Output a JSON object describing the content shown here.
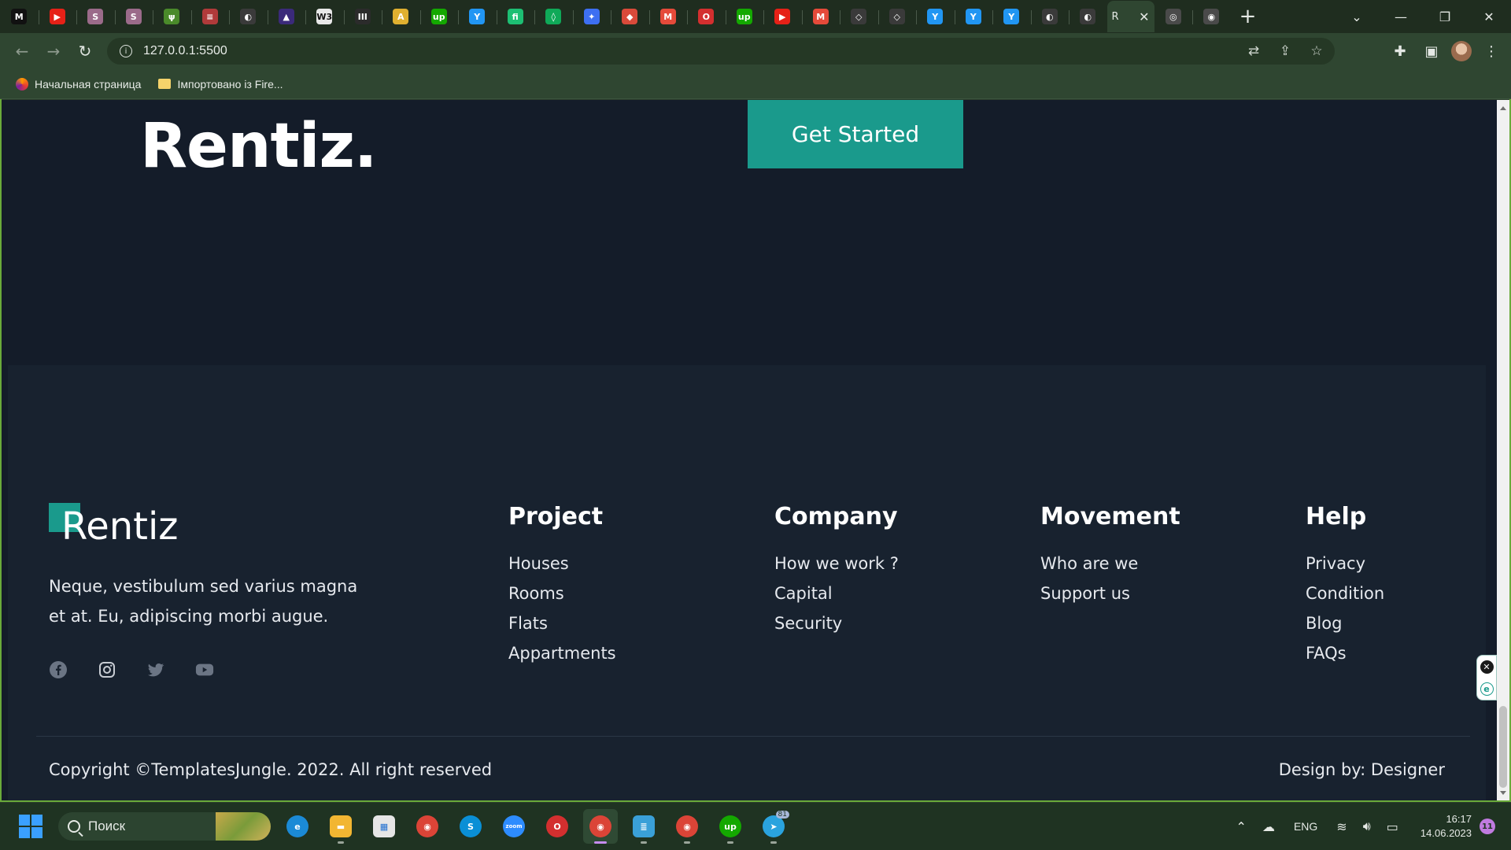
{
  "browser": {
    "active_tab_title": "R",
    "tabs": [
      {
        "icon": "medium-icon",
        "glyph": "M",
        "color": "#111111"
      },
      {
        "icon": "youtube-icon",
        "glyph": "▶",
        "color": "#e62117"
      },
      {
        "icon": "book-icon",
        "glyph": "S",
        "color": "#9b6b8a"
      },
      {
        "icon": "book-icon",
        "glyph": "S",
        "color": "#9b6b8a"
      },
      {
        "icon": "leaf-icon",
        "glyph": "ψ",
        "color": "#4a8a2a"
      },
      {
        "icon": "stack-icon",
        "glyph": "≡",
        "color": "#b03a3a"
      },
      {
        "icon": "globe-icon",
        "glyph": "◐",
        "color": "#3a3a3a"
      },
      {
        "icon": "mountain-icon",
        "glyph": "▲",
        "color": "#3b2a7a"
      },
      {
        "icon": "w3schools-icon",
        "glyph": "W3",
        "color": "#e8e8e8"
      },
      {
        "icon": "gallery-icon",
        "glyph": "III",
        "color": "#2b2b2b"
      },
      {
        "icon": "translate-icon",
        "glyph": "A",
        "color": "#e0b030"
      },
      {
        "icon": "upwork-icon",
        "glyph": "up",
        "color": "#14a800"
      },
      {
        "icon": "bird-icon",
        "glyph": "Y",
        "color": "#2196f3"
      },
      {
        "icon": "fiverr-icon",
        "glyph": "fi",
        "color": "#1dbf73"
      },
      {
        "icon": "drop-icon",
        "glyph": "◊",
        "color": "#0fa958"
      },
      {
        "icon": "figma-icon",
        "glyph": "✦",
        "color": "#3d6ff2"
      },
      {
        "icon": "diamond-icon",
        "glyph": "◆",
        "color": "#d94a3a"
      },
      {
        "icon": "gmail-icon",
        "glyph": "M",
        "color": "#e54a3a"
      },
      {
        "icon": "opera-icon",
        "glyph": "O",
        "color": "#d32f2f"
      },
      {
        "icon": "upwork-icon",
        "glyph": "up",
        "color": "#14a800"
      },
      {
        "icon": "youtube-icon",
        "glyph": "▶",
        "color": "#e62117"
      },
      {
        "icon": "gmail-icon",
        "glyph": "M",
        "color": "#e54a3a"
      },
      {
        "icon": "gem-icon",
        "glyph": "◇",
        "color": "#3a3a3a"
      },
      {
        "icon": "gem-icon",
        "glyph": "◇",
        "color": "#3a3a3a"
      },
      {
        "icon": "bird-icon",
        "glyph": "Y",
        "color": "#2196f3"
      },
      {
        "icon": "bird-icon",
        "glyph": "Y",
        "color": "#2196f3"
      },
      {
        "icon": "bird-icon",
        "glyph": "Y",
        "color": "#2196f3"
      },
      {
        "icon": "globe-icon",
        "glyph": "◐",
        "color": "#3a3a3a"
      },
      {
        "icon": "globe-icon",
        "glyph": "◐",
        "color": "#3a3a3a"
      }
    ],
    "trailing_tabs": [
      {
        "icon": "settings-icon",
        "glyph": "◎",
        "color": "#4a4a4a"
      },
      {
        "icon": "chrome-icon",
        "glyph": "◉",
        "color": "#4a4a4a"
      }
    ],
    "url": "127.0.0.1:5500",
    "bookmarks": [
      {
        "label": "Начальная страница",
        "type": "firefox"
      },
      {
        "label": "Імпортовано із Fire...",
        "type": "folder"
      }
    ]
  },
  "page": {
    "cta": {
      "logo": "Rentiz.",
      "button_label": "Get Started"
    },
    "footer": {
      "logo": "Rentiz",
      "description": "Neque, vestibulum sed varius magna et at. Eu, adipiscing morbi augue.",
      "socials": [
        "facebook-icon",
        "instagram-icon",
        "twitter-icon",
        "youtube-icon"
      ],
      "columns": [
        {
          "title": "Project",
          "links": [
            "Houses",
            "Rooms",
            "Flats",
            "Appartments"
          ]
        },
        {
          "title": "Company",
          "links": [
            "How we work ?",
            "Capital",
            "Security"
          ]
        },
        {
          "title": "Movement",
          "links": [
            "Who are we",
            "Support us"
          ]
        },
        {
          "title": "Help",
          "links": [
            "Privacy",
            "Condition",
            "Blog",
            "FAQs"
          ]
        }
      ],
      "copyright": "Copyright ©TemplatesJungle. 2022. All right reserved",
      "design_by": "Design by: Designer"
    },
    "colors": {
      "accent": "#1a9a8c",
      "page_bg": "#141c29",
      "footer_bg": "#18222f"
    }
  },
  "taskbar": {
    "search_label": "Поиск",
    "apps": [
      {
        "icon": "edge-icon",
        "glyph": "e",
        "color": "#1b8ad6",
        "dot": false
      },
      {
        "icon": "file-explorer-icon",
        "glyph": "▬",
        "color": "#f2b632",
        "dot": true
      },
      {
        "icon": "microsoft-store-icon",
        "glyph": "▦",
        "color": "#e6e6e6",
        "dot": false
      },
      {
        "icon": "chrome-icon",
        "glyph": "◉",
        "color": "#db4437",
        "dot": false
      },
      {
        "icon": "skype-icon",
        "glyph": "S",
        "color": "#0a8fd6",
        "dot": false
      },
      {
        "icon": "zoom-icon",
        "glyph": "zoom",
        "color": "#2d8cff",
        "dot": false
      },
      {
        "icon": "opera-icon",
        "glyph": "O",
        "color": "#d32f2f",
        "dot": false
      },
      {
        "icon": "chrome-profile-icon",
        "glyph": "◉",
        "color": "#db4437",
        "dot": true,
        "active": true
      },
      {
        "icon": "notepad-icon",
        "glyph": "≣",
        "color": "#3aa0d8",
        "dot": true
      },
      {
        "icon": "chrome-profile-icon",
        "glyph": "◉",
        "color": "#db4437",
        "dot": true
      },
      {
        "icon": "upwork-icon",
        "glyph": "up",
        "color": "#14a800",
        "dot": true
      },
      {
        "icon": "telegram-icon",
        "glyph": "➤",
        "color": "#2aa3de",
        "dot": true,
        "badge": "81"
      }
    ],
    "tray": {
      "language": "ENG",
      "time": "16:17",
      "date": "14.06.2023",
      "notifications": "11"
    }
  }
}
